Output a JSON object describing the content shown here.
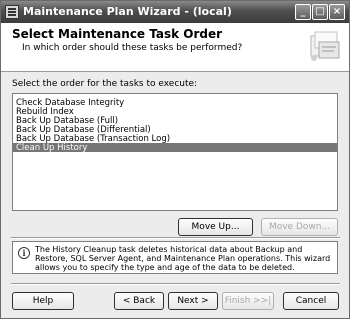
{
  "window": {
    "title": "Maintenance Plan Wizard - (local)",
    "controls": {
      "minimize": "_",
      "maximize": "□",
      "close": "×"
    }
  },
  "header": {
    "title": "Select Maintenance Task Order",
    "subtitle": "In which order should these tasks be performed?",
    "graphic_icon": "wizard-graphic-icon"
  },
  "order_section": {
    "instruction": "Select the order for the tasks to execute:",
    "tasks": [
      "Check Database Integrity",
      "Rebuild Index",
      "Back Up Database (Full)",
      "Back Up Database (Differential)",
      "Back Up Database (Transaction Log)",
      "Clean Up History"
    ],
    "selected": "Clean Up History",
    "move_up_label": "Move Up...",
    "move_down_label": "Move Down..."
  },
  "info": {
    "icon": "info-icon",
    "text": "The History Cleanup task deletes historical data about Backup and Restore, SQL Server Agent, and Maintenance Plan operations.  This wizard allows you to specify the type and age of the data to be deleted."
  },
  "footer": {
    "help_label": "Help",
    "back_label": "< Back",
    "next_label": "Next >",
    "finish_label": "Finish >>|",
    "cancel_label": "Cancel"
  },
  "colors": {
    "title_bar": "#4e4e4e",
    "selection": "#767676",
    "dialog_bg": "#ececec"
  }
}
